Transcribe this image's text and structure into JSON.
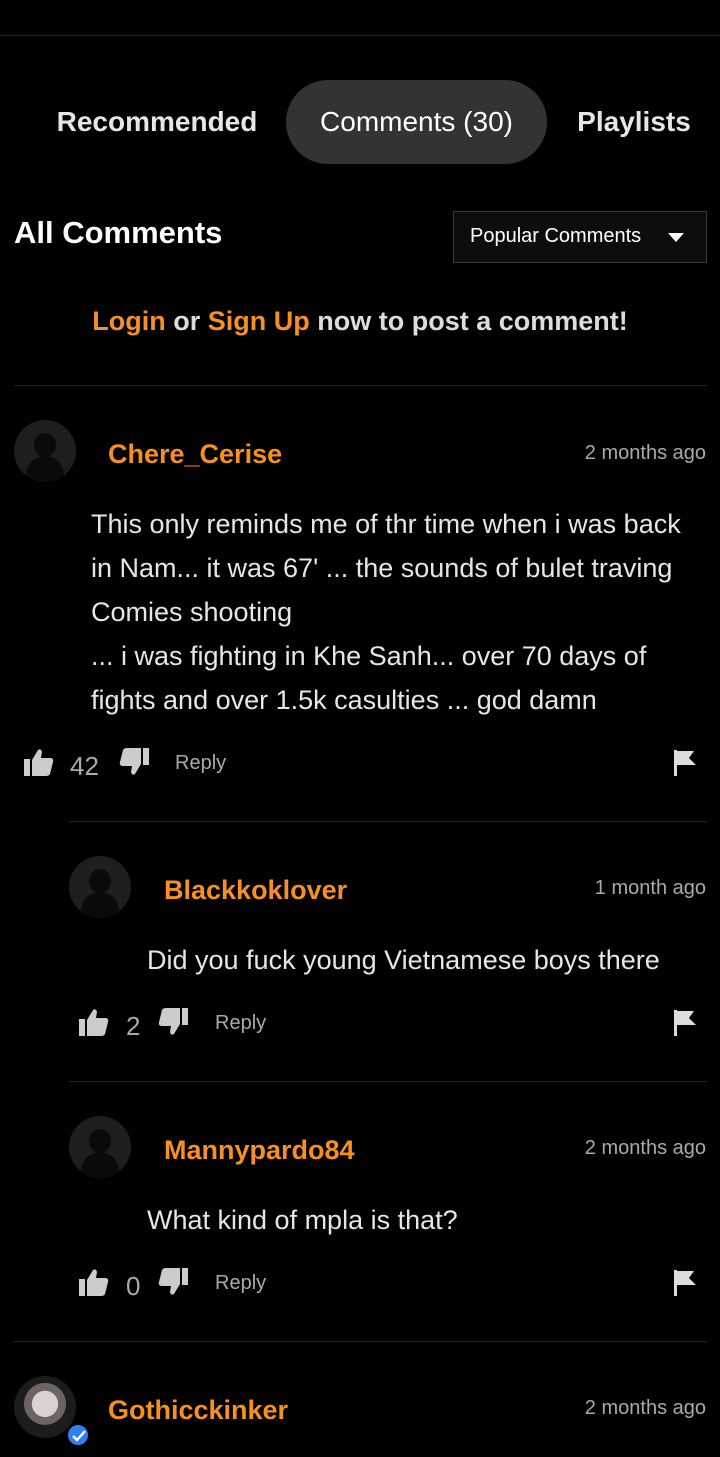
{
  "tabs": [
    {
      "label": "Recommended"
    },
    {
      "label": "Comments (30)"
    },
    {
      "label": "Playlists"
    }
  ],
  "comments_section": {
    "heading": "All Comments",
    "sort": {
      "selected": "Popular Comments"
    },
    "login_prompt": {
      "login": "Login",
      "or": " or ",
      "signup": "Sign Up",
      "rest": " now to post a comment!"
    }
  },
  "comments": [
    {
      "username": "Chere_Cerise",
      "time": "2 months ago",
      "text": "This only reminds me of thr time when i was back in Nam... it was 67' ... the sounds of bulet traving Comies shooting",
      "text2": "... i was fighting in Khe Sanh... over 70 days of fights and over 1.5k casulties ... god damn",
      "likes": "42",
      "reply_label": "Reply"
    },
    {
      "username": "Blackkoklover",
      "time": "1 month ago",
      "text": "Did you fuck young Vietnamese boys there",
      "likes": "2",
      "reply_label": "Reply"
    },
    {
      "username": "Mannypardo84",
      "time": "2 months ago",
      "text": "What kind of mpla is that?",
      "likes": "0",
      "reply_label": "Reply"
    },
    {
      "username": "Gothicckinker",
      "time": "2 months ago"
    }
  ],
  "colors": {
    "accent": "#f7901e",
    "background": "#000000",
    "tab_active_bg": "#333333",
    "verified": "#2f80ed"
  },
  "icons": {
    "like": "thumbs-up-icon",
    "dislike": "thumbs-down-icon",
    "report": "flag-icon",
    "sort": "caret-down-icon",
    "verified": "check-badge-icon"
  }
}
